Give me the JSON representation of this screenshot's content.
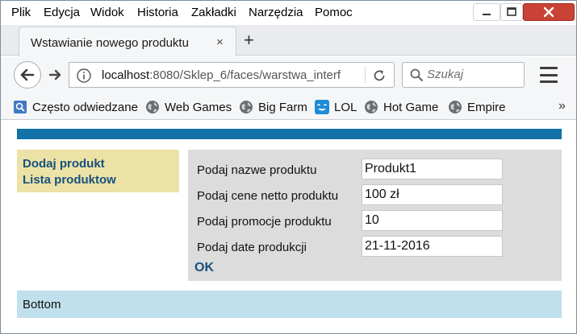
{
  "menubar": {
    "items": [
      "Plik",
      "Edycja",
      "Widok",
      "Historia",
      "Zakładki",
      "Narzędzia",
      "Pomoc"
    ]
  },
  "tab": {
    "title": "Wstawianie nowego produktu",
    "close": "×",
    "new": "+"
  },
  "navbar": {
    "url_host": "localhost",
    "url_rest": ":8080/Sklep_6/faces/warstwa_interf",
    "search_placeholder": "Szukaj"
  },
  "bookmarks": {
    "items": [
      {
        "label": "Często odwiedzane",
        "icon": "frequent-icon"
      },
      {
        "label": "Web Games",
        "icon": "globe-icon"
      },
      {
        "label": "Big Farm",
        "icon": "globe-icon"
      },
      {
        "label": "LOL",
        "icon": "lol-icon"
      },
      {
        "label": "Hot Game",
        "icon": "globe-icon"
      },
      {
        "label": "Empire",
        "icon": "globe-icon"
      }
    ],
    "more": "»"
  },
  "sidebar": {
    "add_product": "Dodaj produkt",
    "product_list": "Lista produktow"
  },
  "form": {
    "name_label": "Podaj nazwe produktu",
    "name_value": "Produkt1",
    "price_label": "Podaj cene netto produktu",
    "price_value": "100 zł",
    "promo_label": "Podaj promocje produktu",
    "promo_value": "10",
    "date_label": "Podaj date produkcji",
    "date_value": "21-11-2016",
    "ok": "OK"
  },
  "footer": {
    "text": "Bottom"
  },
  "colors": {
    "top_bar": "#1271a6",
    "sidebar_bg": "#ede2a6",
    "link": "#15517f",
    "form_bg": "#dcdcdc",
    "bottom_bg": "#bfe0ec",
    "close_button": "#c94235"
  }
}
